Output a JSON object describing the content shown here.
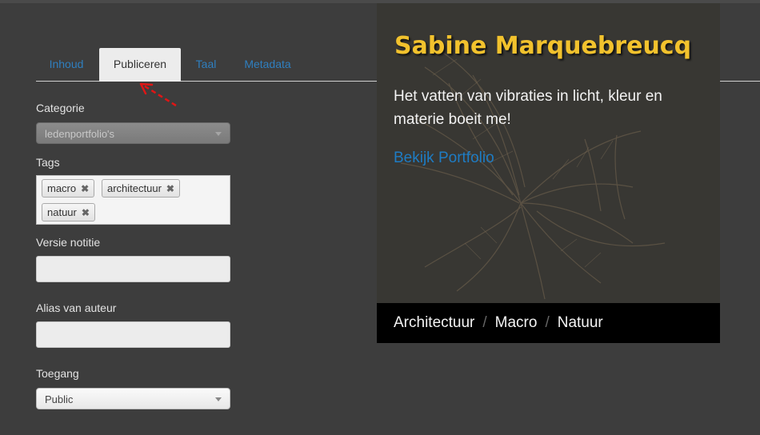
{
  "tabs": [
    {
      "label": "Inhoud",
      "active": false
    },
    {
      "label": "Publiceren",
      "active": true
    },
    {
      "label": "Taal",
      "active": false
    },
    {
      "label": "Metadata",
      "active": false
    }
  ],
  "form": {
    "category_label": "Categorie",
    "category_value": "ledenportfolio's",
    "tags_label": "Tags",
    "tags": [
      "macro",
      "architectuur",
      "natuur"
    ],
    "tag_remove_glyph": "✖",
    "version_note_label": "Versie notitie",
    "version_note_value": "",
    "author_alias_label": "Alias van auteur",
    "author_alias_value": "",
    "access_label": "Toegang",
    "access_value": "Public"
  },
  "card": {
    "title": "Sabine Marquebreucq",
    "text": "Het vatten van vibraties in licht, kleur en materie boeit me!",
    "link": "Bekijk Portfolio",
    "categories": [
      "Architectuur",
      "Macro",
      "Natuur"
    ],
    "separator": "/"
  },
  "colors": {
    "background": "#3d3d3d",
    "tab_link": "#2f7fbf",
    "title_yellow": "#f2c22d",
    "portfolio_link": "#1e7cc4",
    "annotation_red": "#e01515"
  },
  "icons": {
    "annotation": "red-dashed-arrow-icon",
    "select_caret": "caret-down-icon",
    "tag_remove": "close-icon"
  }
}
